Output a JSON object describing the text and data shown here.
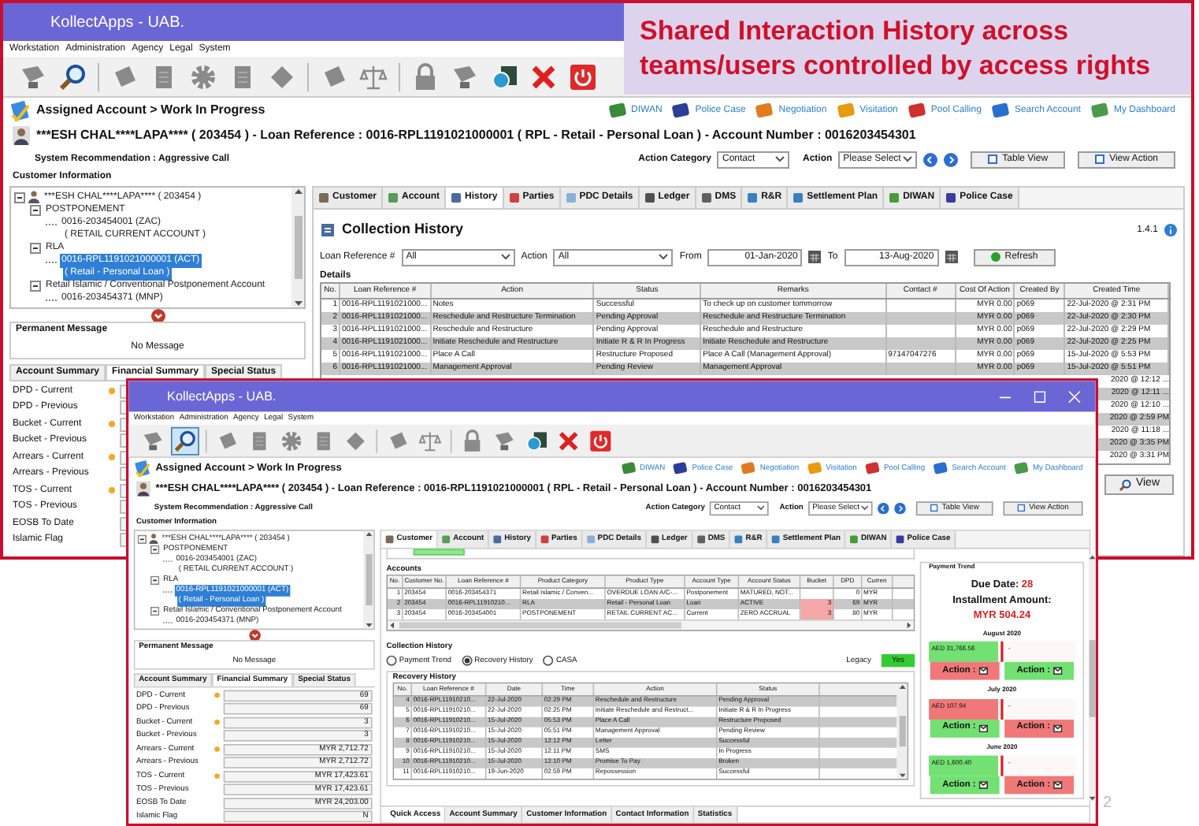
{
  "banner": "Shared Interaction History across teams/users controlled by access rights",
  "slide_number": "2",
  "back_window": {
    "title": "KollectApps - UAB.",
    "menu": [
      "Workstation",
      "Administration",
      "Agency",
      "Legal",
      "System"
    ],
    "toolbar": [
      {
        "selected": false
      },
      {
        "selected": false
      },
      {
        "selected": false
      },
      {
        "selected": false
      },
      {
        "selected": false
      },
      {
        "selected": false
      },
      {
        "selected": false
      },
      {
        "selected": false
      },
      {
        "selected": false
      },
      {
        "selected": false
      },
      {
        "selected": false
      },
      {
        "selected": false
      },
      {
        "selected": false
      },
      {
        "selected": false
      }
    ],
    "breadcrumb": "Assigned Account > Work In Progress",
    "quick_links": [
      "DIWAN",
      "Police Case",
      "Negotiation",
      "Visitation",
      "Pool Calling",
      "Search Account",
      "My Dashboard"
    ],
    "customer_line": "***ESH CHAL****LAPA**** ( 203454 ) -  Loan Reference : 0016-RPL1191021000001 ( RPL - Retail - Personal Loan ) - Account Number : 0016203454301",
    "recommendation": "System Recommendation : Aggressive Call",
    "action_category": {
      "label": "Action Category",
      "value": "Contact"
    },
    "action": {
      "label": "Action",
      "value": "Please Select"
    },
    "action_buttons": [
      "Table View",
      "View Action"
    ],
    "customer_info_label": "Customer Information",
    "tree": [
      {
        "label": "***ESH CHAL****LAPA**** ( 203454 )",
        "expanded": true,
        "children": [
          {
            "label": "POSTPONEMENT",
            "expanded": true,
            "children": [
              {
                "label": "0016-203454001 (ZAC)",
                "sublabel": "( RETAIL CURRENT ACCOUNT )",
                "selected": false
              }
            ]
          },
          {
            "label": "RLA",
            "expanded": true,
            "children": [
              {
                "label": "0016-RPL1191021000001 (ACT)",
                "sublabel": "( Retail - Personal Loan )",
                "selected": true
              }
            ]
          },
          {
            "label": "Retail Islamic / Conventional Postponement Account",
            "expanded": true,
            "children": [
              {
                "label": "0016-203454371 (MNP)",
                "selected": false
              }
            ]
          }
        ]
      }
    ],
    "permanent_message": {
      "title": "Permanent Message",
      "text": "No Message"
    },
    "summary_tabs": [
      {
        "label": "Account Summary",
        "selected": false
      },
      {
        "label": "Financial Summary",
        "selected": true
      },
      {
        "label": "Special Status",
        "selected": false
      }
    ],
    "summary_rows": [
      {
        "label": "DPD - Current",
        "flag": true
      },
      {
        "label": "DPD - Previous",
        "flag": false
      },
      {
        "label": "Bucket - Current",
        "flag": true
      },
      {
        "label": "Bucket - Previous",
        "flag": false
      },
      {
        "label": "Arrears - Current",
        "flag": true
      },
      {
        "label": "Arrears - Previous",
        "flag": false
      },
      {
        "label": "TOS - Current",
        "flag": true
      },
      {
        "label": "TOS - Previous",
        "flag": false
      },
      {
        "label": "EOSB To Date",
        "flag": false
      },
      {
        "label": "Islamic Flag",
        "flag": false
      }
    ],
    "main_tabs": [
      {
        "label": "Customer",
        "selected": false
      },
      {
        "label": "Account",
        "selected": false
      },
      {
        "label": "History",
        "selected": true
      },
      {
        "label": "Parties",
        "selected": false
      },
      {
        "label": "PDC Details",
        "selected": false
      },
      {
        "label": "Ledger",
        "selected": false
      },
      {
        "label": "DMS",
        "selected": false
      },
      {
        "label": "R&R",
        "selected": false
      },
      {
        "label": "Settlement Plan",
        "selected": false
      },
      {
        "label": "DIWAN",
        "selected": false
      },
      {
        "label": "Police Case",
        "selected": false
      }
    ],
    "content": {
      "kind": "history",
      "title": "Collection History",
      "version": "1.4.1",
      "loan_filter": {
        "label": "Loan Reference #",
        "value": "All"
      },
      "action_filter": {
        "label": "Action",
        "value": "All"
      },
      "from": {
        "label": "From",
        "value": "01-Jan-2020"
      },
      "to": {
        "label": "To",
        "value": "13-Aug-2020"
      },
      "refresh": "Refresh",
      "details_label": "Details",
      "columns": [
        "No.",
        "Loan Reference #",
        "Action",
        "Status",
        "Remarks",
        "Contact #",
        "Cost Of Action",
        "Created By",
        "Created Time"
      ],
      "rows": [
        [
          "1",
          "0016-RPL1191021000...",
          "Notes",
          "Successful",
          "To check up on customer tommorrow",
          "",
          "MYR 0.00",
          "p069",
          "22-Jul-2020 @ 2:31 PM"
        ],
        [
          "2",
          "0016-RPL1191021000...",
          "Reschedule and Restructure Termination",
          "Pending Approval",
          "Reschedule and Restructure Termination",
          "",
          "MYR 0.00",
          "p069",
          "22-Jul-2020 @ 2:30 PM"
        ],
        [
          "3",
          "0016-RPL1191021000...",
          "Reschedule and Restructure",
          "Pending Approval",
          "Reschedule and Restructure",
          "",
          "MYR 0.00",
          "p069",
          "22-Jul-2020 @ 2:29 PM"
        ],
        [
          "4",
          "0016-RPL1191021000...",
          "Initiate Reschedule and Restructure",
          "Initiate R & R In Progress",
          "Initiate Reschedule and Restructure",
          "",
          "MYR 0.00",
          "p069",
          "22-Jul-2020 @ 2:25 PM"
        ],
        [
          "5",
          "0016-RPL1191021000...",
          "Place A Call",
          "Restructure Proposed",
          "Place A Call (Management Approval)",
          "97147047276",
          "MYR 0.00",
          "p069",
          "15-Jul-2020 @ 5:53 PM"
        ],
        [
          "6",
          "0016-RPL1191021000...",
          "Management Approval",
          "Pending Review",
          "Management Approval",
          "",
          "MYR 0.00",
          "p069",
          "15-Jul-2020 @ 5:51 PM"
        ]
      ],
      "partial_rows": [
        "2020 @ 12:12 ...",
        "2020 @ 12:11 ...",
        "2020 @ 12:10 ...",
        "2020 @ 2:59 PM",
        "2020 @ 11:18 ...",
        "2020 @ 3:35 PM",
        "2020 @ 3:31 PM"
      ],
      "view_button": "View"
    }
  },
  "front_window": {
    "title": "KollectApps - UAB.",
    "window_controls": true,
    "menu": [
      "Workstation",
      "Administration",
      "Agency",
      "Legal",
      "System"
    ],
    "toolbar": [
      {
        "selected": false
      },
      {
        "selected": true
      },
      {
        "selected": false
      },
      {
        "selected": false
      },
      {
        "selected": false
      },
      {
        "selected": false
      },
      {
        "selected": false
      },
      {
        "selected": false
      },
      {
        "selected": false
      },
      {
        "selected": false
      },
      {
        "selected": false
      },
      {
        "selected": false
      },
      {
        "selected": false
      },
      {
        "selected": false
      }
    ],
    "breadcrumb": "Assigned Account > Work In Progress",
    "quick_links": [
      "DIWAN",
      "Police Case",
      "Negotiation",
      "Visitation",
      "Pool Calling",
      "Search Account",
      "My Dashboard"
    ],
    "customer_line": "***ESH CHAL****LAPA**** ( 203454 ) -  Loan Reference : 0016-RPL1191021000001 ( RPL - Retail - Personal Loan ) - Account Number : 0016203454301",
    "recommendation": "System Recommendation : Aggressive Call",
    "action_category": {
      "label": "Action Category",
      "value": "Contact"
    },
    "action": {
      "label": "Action",
      "value": "Please Select"
    },
    "action_buttons": [
      "Table View",
      "View Action"
    ],
    "customer_info_label": "Customer Information",
    "tree": [
      {
        "label": "***ESH CHAL****LAPA**** ( 203454 )",
        "expanded": true,
        "children": [
          {
            "label": "POSTPONEMENT",
            "expanded": true,
            "children": [
              {
                "label": "0016-203454001 (ZAC)",
                "sublabel": "( RETAIL CURRENT ACCOUNT )",
                "selected": false
              }
            ]
          },
          {
            "label": "RLA",
            "expanded": true,
            "children": [
              {
                "label": "0016-RPL1191021000001 (ACT)",
                "sublabel": "( Retail - Personal Loan )",
                "selected": true
              }
            ]
          },
          {
            "label": "Retail Islamic / Conventional Postponement Account",
            "expanded": true,
            "children": [
              {
                "label": "0016-203454371 (MNP)",
                "selected": false
              }
            ]
          }
        ]
      }
    ],
    "permanent_message": {
      "title": "Permanent Message",
      "text": "No Message"
    },
    "summary_tabs": [
      {
        "label": "Account Summary",
        "selected": false
      },
      {
        "label": "Financial Summary",
        "selected": true
      },
      {
        "label": "Special Status",
        "selected": false
      }
    ],
    "summary_rows": [
      {
        "label": "DPD - Current",
        "flag": true,
        "value": "69"
      },
      {
        "label": "DPD - Previous",
        "flag": false,
        "value": "69"
      },
      {
        "label": "Bucket - Current",
        "flag": true,
        "value": "3"
      },
      {
        "label": "Bucket - Previous",
        "flag": false,
        "value": "3"
      },
      {
        "label": "Arrears - Current",
        "flag": true,
        "value": "MYR 2,712.72"
      },
      {
        "label": "Arrears - Previous",
        "flag": false,
        "value": "MYR 2,712.72"
      },
      {
        "label": "TOS - Current",
        "flag": true,
        "value": "MYR 17,423.61"
      },
      {
        "label": "TOS - Previous",
        "flag": false,
        "value": "MYR 17,423.61"
      },
      {
        "label": "EOSB To Date",
        "flag": false,
        "value": "MYR 24,203.00"
      },
      {
        "label": "Islamic Flag",
        "flag": false,
        "value": "N"
      }
    ],
    "main_tabs": [
      {
        "label": "Customer",
        "selected": true
      },
      {
        "label": "Account",
        "selected": false
      },
      {
        "label": "History",
        "selected": false
      },
      {
        "label": "Parties",
        "selected": false
      },
      {
        "label": "PDC Details",
        "selected": false
      },
      {
        "label": "Ledger",
        "selected": false
      },
      {
        "label": "DMS",
        "selected": false
      },
      {
        "label": "R&R",
        "selected": false
      },
      {
        "label": "Settlement Plan",
        "selected": false
      },
      {
        "label": "DIWAN",
        "selected": false
      },
      {
        "label": "Police Case",
        "selected": false
      }
    ],
    "content": {
      "kind": "customer",
      "accounts": {
        "title": "Accounts",
        "columns": [
          "No.",
          "Customer No.",
          "Loan Reference #",
          "Product Category",
          "Product Type",
          "Account Type",
          "Account Status",
          "Bucket",
          "DPD",
          "Curren"
        ],
        "rows": [
          {
            "cells": [
              "1",
              "203454",
              "0016-203454371",
              "Retail Islamic / Conven...",
              "OVERDUE LOAN A/C-...",
              "Postponement",
              "MATURED, NOT...",
              "",
              "0",
              "MYR"
            ],
            "selected": false,
            "alert": false
          },
          {
            "cells": [
              "2",
              "203454",
              "0016-RPL11910210...",
              "RLA",
              "Retail - Personal Loan",
              "Loan",
              "ACTIVE",
              "3",
              "69",
              "MYR"
            ],
            "selected": true,
            "alert": true
          },
          {
            "cells": [
              "3",
              "203454",
              "0016-203454001",
              "POSTPONEMENT",
              "RETAIL CURRENT AC...",
              "Current",
              "ZERO ACCRUAL",
              "3",
              "80",
              "MYR"
            ],
            "selected": false,
            "alert": true
          }
        ]
      },
      "history_title": "Collection History",
      "radios": [
        {
          "label": "Payment Trend",
          "selected": false
        },
        {
          "label": "Recovery History",
          "selected": true
        },
        {
          "label": "CASA",
          "selected": false
        }
      ],
      "legacy": {
        "label": "Legacy",
        "value": "Yes"
      },
      "recovery": {
        "title": "Recovery History",
        "columns": [
          "No.",
          "Loan Reference #",
          "Date",
          "Time",
          "Action",
          "Status"
        ],
        "rows": [
          [
            "4",
            "0016-RPL11910210...",
            "22-Jul-2020",
            "02:29 PM",
            "Reschedule and Restructure",
            "Pending Approval"
          ],
          [
            "5",
            "0016-RPL11910210...",
            "22-Jul-2020",
            "02:25 PM",
            "Initiate Reschedule and Restruct...",
            "Initiate R & R In Progress"
          ],
          [
            "6",
            "0016-RPL11910210...",
            "15-Jul-2020",
            "05:53 PM",
            "Place A Call",
            "Restructure Proposed"
          ],
          [
            "7",
            "0016-RPL11910210...",
            "15-Jul-2020",
            "05:51 PM",
            "Management Approval",
            "Pending Review"
          ],
          [
            "8",
            "0016-RPL11910210...",
            "15-Jul-2020",
            "12:12 PM",
            "Letter",
            "Successful"
          ],
          [
            "9",
            "0016-RPL11910210...",
            "15-Jul-2020",
            "12:11 PM",
            "SMS",
            "In Progress"
          ],
          [
            "10",
            "0016-RPL11910210...",
            "15-Jul-2020",
            "12:10 PM",
            "Promise To Pay",
            "Broken"
          ],
          [
            "11",
            "0016-RPL11910210...",
            "19-Jun-2020",
            "02:59 PM",
            "Repossession",
            "Successful"
          ]
        ]
      },
      "bottom_tabs": [
        {
          "label": "Quick Access",
          "selected": true
        },
        {
          "label": "Account Summary",
          "selected": false
        },
        {
          "label": "Customer Information",
          "selected": false
        },
        {
          "label": "Contact Information",
          "selected": false
        },
        {
          "label": "Statistics",
          "selected": false
        }
      ],
      "payment_trend": {
        "title": "Payment Trend",
        "due_label": "Due Date:",
        "due_value": "28",
        "installment_label": "Installment Amount:",
        "installment_value": "MYR 504.24",
        "months": [
          {
            "month": "August 2020",
            "amount": "AED 31,766.56",
            "paid": true,
            "other": "-",
            "actions": [
              {
                "label": "Action :",
                "paid": false
              },
              {
                "label": "Action :",
                "paid": true
              }
            ]
          },
          {
            "month": "July 2020",
            "amount": "AED 107.94",
            "paid": false,
            "other": "-",
            "actions": [
              {
                "label": "Action :",
                "paid": true
              },
              {
                "label": "Action :",
                "paid": false
              }
            ]
          },
          {
            "month": "June 2020",
            "amount": "AED 1,600.40",
            "paid": true,
            "other": "-",
            "actions": [
              {
                "label": "Action :",
                "paid": true
              },
              {
                "label": "Action :",
                "paid": false
              }
            ]
          }
        ]
      }
    }
  }
}
